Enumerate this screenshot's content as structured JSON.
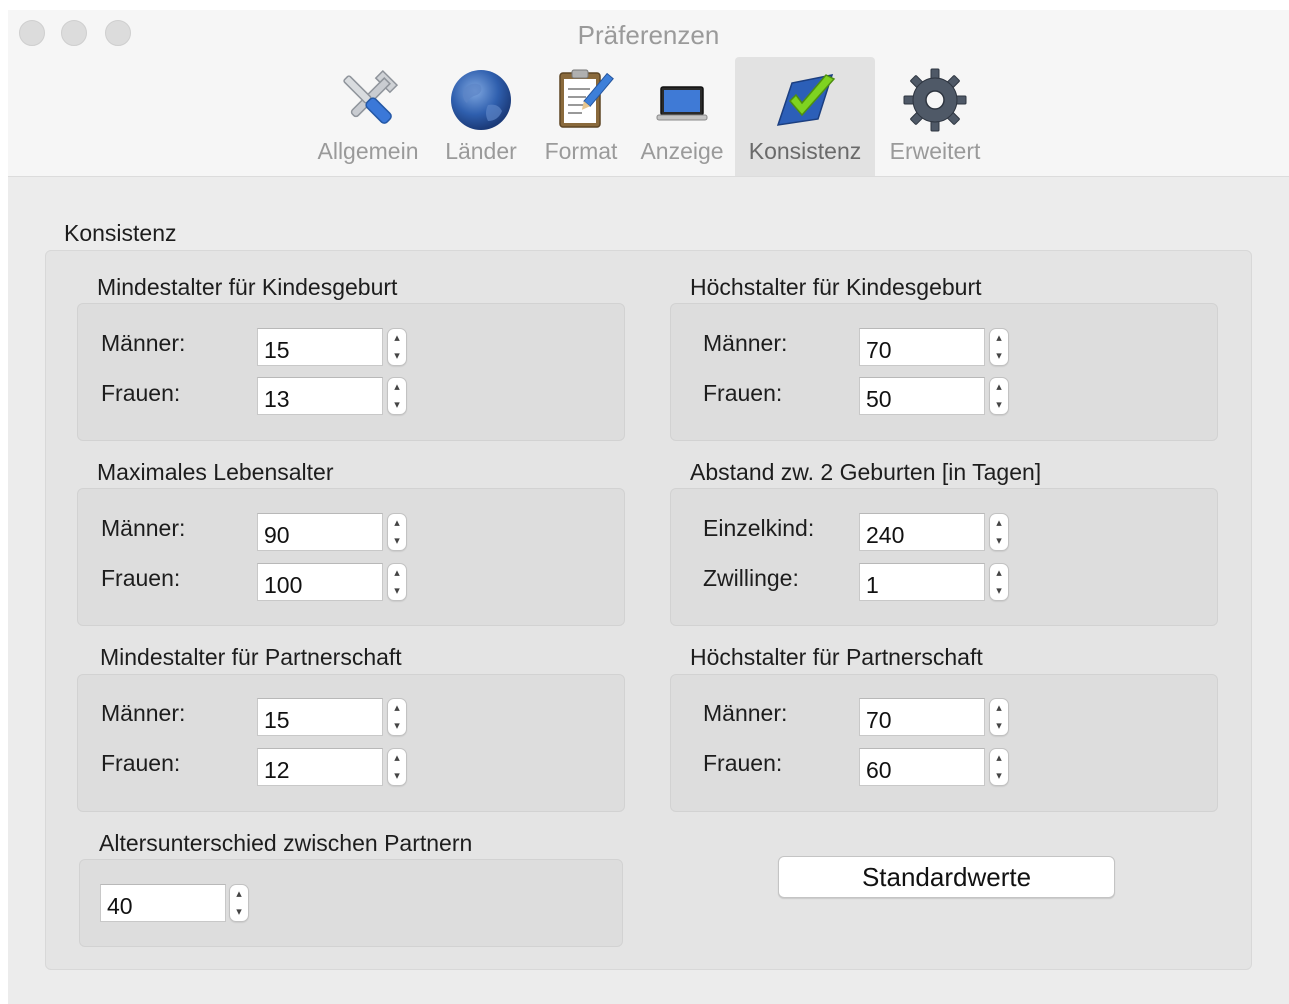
{
  "window": {
    "title": "Präferenzen"
  },
  "toolbar": {
    "tabs": [
      {
        "label": "Allgemein",
        "icon": "tools-icon"
      },
      {
        "label": "Länder",
        "icon": "globe-icon"
      },
      {
        "label": "Format",
        "icon": "clipboard-pencil-icon"
      },
      {
        "label": "Anzeige",
        "icon": "laptop-icon"
      },
      {
        "label": "Konsistenz",
        "icon": "checkmark-icon",
        "active": true
      },
      {
        "label": "Erweitert",
        "icon": "gear-icon"
      }
    ]
  },
  "section": {
    "title": "Konsistenz"
  },
  "groups": {
    "min_birth": {
      "title": "Mindestalter für Kindesgeburt",
      "row1": {
        "label": "Männer:",
        "value": "15"
      },
      "row2": {
        "label": "Frauen:",
        "value": "13"
      }
    },
    "max_birth": {
      "title": "Höchstalter für Kindesgeburt",
      "row1": {
        "label": "Männer:",
        "value": "70"
      },
      "row2": {
        "label": "Frauen:",
        "value": "50"
      }
    },
    "max_life": {
      "title": "Maximales Lebensalter",
      "row1": {
        "label": "Männer:",
        "value": "90"
      },
      "row2": {
        "label": "Frauen:",
        "value": "100"
      }
    },
    "birth_gap": {
      "title": "Abstand zw. 2 Geburten [in Tagen]",
      "row1": {
        "label": "Einzelkind:",
        "value": "240"
      },
      "row2": {
        "label": "Zwillinge:",
        "value": "1"
      }
    },
    "min_partner": {
      "title": "Mindestalter für Partnerschaft",
      "row1": {
        "label": "Männer:",
        "value": "15"
      },
      "row2": {
        "label": "Frauen:",
        "value": "12"
      }
    },
    "max_partner": {
      "title": "Höchstalter für Partnerschaft",
      "row1": {
        "label": "Männer:",
        "value": "70"
      },
      "row2": {
        "label": "Frauen:",
        "value": "60"
      }
    },
    "age_diff": {
      "title": "Altersunterschied zwischen Partnern",
      "value": "40"
    }
  },
  "buttons": {
    "defaults_label": "Standardwerte"
  },
  "colors": {
    "window_bg": "#ececec",
    "titlebar_bg": "#f6f6f6",
    "title_text": "#9a9a9a",
    "accent_check": "#7fd320",
    "accent_blue": "#2c6bd0"
  }
}
